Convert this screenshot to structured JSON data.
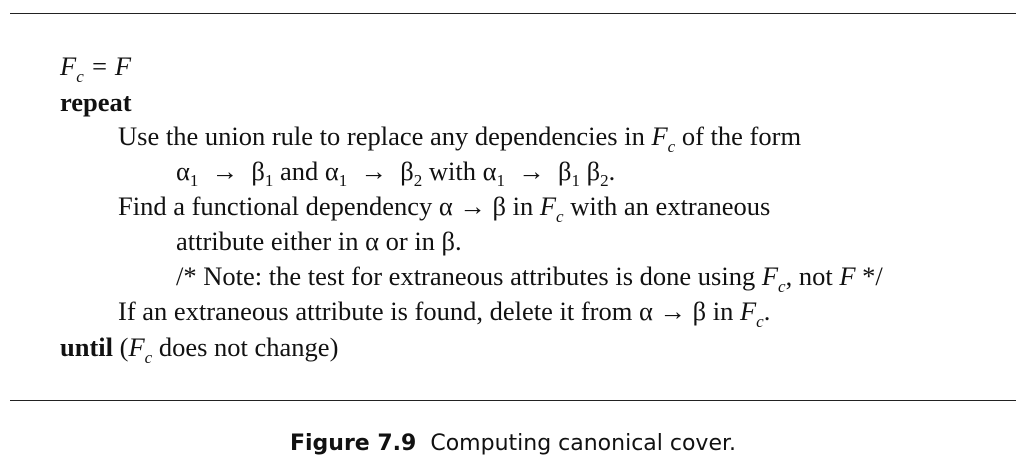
{
  "algorithm": {
    "assign": {
      "lhs": "F",
      "lhs_sub": "c",
      "rest": " = F"
    },
    "repeat_kw": "repeat",
    "union_rule": {
      "text_a": "Use the union rule to replace any dependencies in ",
      "fc": "F",
      "fc_sub": "c",
      "text_b": " of the form"
    },
    "union_form": {
      "a1": "α",
      "a1_sub": "1",
      "arrow1": "  →  ",
      "b1": "β",
      "b1_sub": "1",
      "and": " and ",
      "a1b": "α",
      "a1b_sub": "1",
      "arrow2": "  →  ",
      "b2": "β",
      "b2_sub": "2",
      "with": " with ",
      "a1c": "α",
      "a1c_sub": "1",
      "arrow3": "  →  ",
      "b1c": "β",
      "b1c_sub": "1",
      "sp": " ",
      "b2c": "β",
      "b2c_sub": "2",
      "end": "."
    },
    "find_fd": {
      "text_a": "Find a functional dependency α → β in ",
      "fc": "F",
      "fc_sub": "c",
      "text_b": " with an extraneous"
    },
    "find_fd_cont": "attribute either in α or in β.",
    "note": {
      "text_a": "/* Note: the test for extraneous attributes is done using ",
      "fc": "F",
      "fc_sub": "c",
      "text_b": ", not ",
      "f": "F",
      "text_c": " */"
    },
    "delete": {
      "text_a": "If an extraneous attribute is found, delete it from α → β in ",
      "fc": "F",
      "fc_sub": "c",
      "text_b": "."
    },
    "until": {
      "kw": "until",
      "text_a": " (",
      "fc": "F",
      "fc_sub": "c",
      "text_b": " does not change)"
    }
  },
  "caption": {
    "number": "Figure 7.9",
    "text": "Computing canonical cover."
  }
}
